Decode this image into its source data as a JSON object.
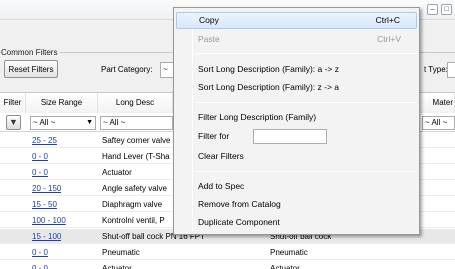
{
  "window": {
    "min_glyph": "–",
    "max_glyph": "□"
  },
  "common_filters": {
    "title": "Common Filters",
    "reset_button": "Reset Filters",
    "part_category_label": "Part Category:",
    "part_category_value": "~",
    "type_label": "t Type:"
  },
  "grid": {
    "columns": [
      "Filter",
      "Size Range",
      "Long Desc",
      "Mater"
    ],
    "filter_values": {
      "size": "~ All ~",
      "desc": "~ All ~",
      "mater": "~ All ~"
    },
    "rows": [
      {
        "size": "25 - 25",
        "desc": "Saftey corner valve",
        "desc2": ""
      },
      {
        "size": "0 - 0",
        "desc": "Hand Lever (T-Sha",
        "desc2": ""
      },
      {
        "size": "0 - 0",
        "desc": "Actuator",
        "desc2": ""
      },
      {
        "size": "20 - 150",
        "desc": "Angle safety valve",
        "desc2": ""
      },
      {
        "size": "15 - 50",
        "desc": "Diaphragm valve",
        "desc2": ""
      },
      {
        "size": "100 - 100",
        "desc": "Kontrolní ventil, P",
        "desc2": ""
      },
      {
        "size": "15 - 100",
        "desc": "Shut-off ball cock PN 16 FPT",
        "desc2": "Shut-off ball cock"
      },
      {
        "size": "0 - 0",
        "desc": "Pneumatic",
        "desc2": "Pneumatic"
      },
      {
        "size": "0 - 0",
        "desc": "Actuator",
        "desc2": "Actuator"
      }
    ]
  },
  "context_menu": {
    "copy": "Copy",
    "copy_shortcut": "Ctrl+C",
    "paste": "Paste",
    "paste_shortcut": "Ctrl+V",
    "sort_az": "Sort Long Description (Family): a -> z",
    "sort_za": "Sort Long Description (Family): z -> a",
    "filter_title": "Filter Long Description (Family)",
    "filter_for": "Filter for",
    "filter_for_value": "",
    "clear_filters": "Clear Filters",
    "add_to_spec": "Add to Spec",
    "remove_from_catalog": "Remove from Catalog",
    "duplicate_component": "Duplicate Component"
  }
}
